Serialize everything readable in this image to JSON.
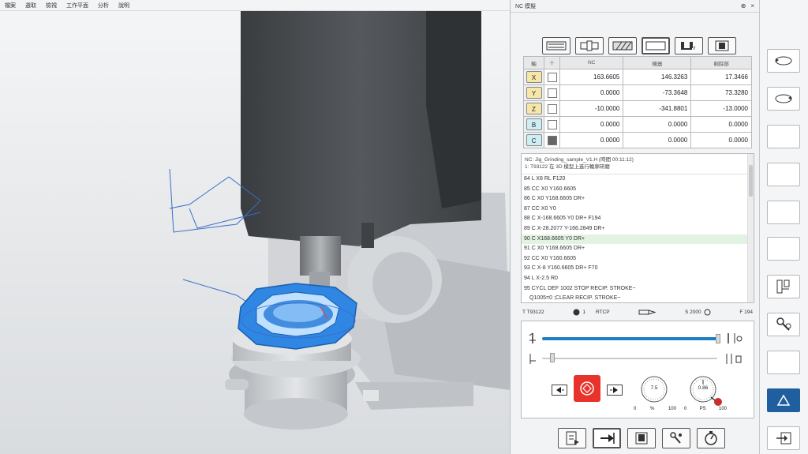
{
  "menu": [
    "檔案",
    "選取",
    "檢視",
    "工作平面",
    "分析",
    "說明"
  ],
  "panel": {
    "title": "NC 模擬",
    "ctl_pin": "⊕",
    "ctl_close": "×"
  },
  "mode_buttons": [
    {
      "icon": "lines-icon"
    },
    {
      "icon": "tool-holder-icon"
    },
    {
      "icon": "hatch-icon"
    },
    {
      "icon": "rectangle-icon"
    },
    {
      "icon": "machine-icon"
    },
    {
      "icon": "program-icon"
    }
  ],
  "axes_table": {
    "headers": [
      "軸",
      "-|-",
      "NC",
      "機器",
      "剩餘部"
    ],
    "rows": [
      {
        "axis": "X",
        "color": "#f6e6a9",
        "checked": false,
        "nc": "163.6605",
        "machine": "146.3263",
        "remain": "17.3466"
      },
      {
        "axis": "Y",
        "color": "#f6e6a9",
        "checked": false,
        "nc": "0.0000",
        "machine": "-73.3648",
        "remain": "73.3280"
      },
      {
        "axis": "Z",
        "color": "#f6e6a9",
        "checked": false,
        "nc": "-10.0000",
        "machine": "-341.8801",
        "remain": "-13.0000"
      },
      {
        "axis": "B",
        "color": "#cdeef2",
        "checked": false,
        "nc": "0.0000",
        "machine": "0.0000",
        "remain": "0.0000"
      },
      {
        "axis": "C",
        "color": "#cdeef2",
        "checked": true,
        "nc": "0.0000",
        "machine": "0.0000",
        "remain": "0.0000"
      }
    ]
  },
  "program": {
    "header1": "NC: Jig_Grinding_sample_V1.H (時間 00:11:12)",
    "header2": "1: T93122 在 3D 模型上進行輪廓研磨",
    "lines": [
      "84 L X8 RL F120",
      "85 CC X0 Y160.6605",
      "86 C X0 Y168.6605 DR+",
      "87 CC X0 Y0",
      "88 C X-168.6605 Y0 DR+ F194",
      "89 C X-28.2077 Y-166.2849 DR+",
      "90 C X168.6605 Y0 DR+",
      "91 C X0 Y168.6605 DR+",
      "92 CC X0 Y160.6605",
      "93 C X-8 Y160.6605 DR+ F70",
      "94 L X-2.5 R0",
      "95 CYCL DEF 1002 STOP RECIP. STROKE~",
      "Q1005=0 ;CLEAR RECIP. STROKE~"
    ],
    "highlight_index": 6
  },
  "status": {
    "tool": "T T93122",
    "tool_no": "1",
    "tcp": "RTCP",
    "spindle": "S 2000",
    "feed": "F 194"
  },
  "controls": {
    "dial1": {
      "value": "7.5",
      "min": "0",
      "unit": "%",
      "max": "100"
    },
    "dial2": {
      "value": "0.86",
      "min": "0",
      "unit": "PS",
      "max": "100"
    }
  },
  "bottom_buttons": [
    {
      "icon": "nc-file-icon"
    },
    {
      "icon": "step-arrow-icon"
    },
    {
      "icon": "machine-view-icon"
    },
    {
      "icon": "wrench-link-icon"
    },
    {
      "icon": "gauge-icon"
    }
  ],
  "side_buttons": [
    {
      "icon": "rotate-view-icon"
    },
    {
      "icon": "rotate-view-2-icon"
    },
    {
      "icon": "blank-icon"
    },
    {
      "icon": "blank-icon"
    },
    {
      "icon": "blank-icon"
    },
    {
      "icon": "blank-icon"
    },
    {
      "icon": "tool-setup-icon"
    },
    {
      "icon": "wrench-gear-icon"
    },
    {
      "icon": "blank-icon"
    },
    {
      "icon": "triangle-up-icon"
    },
    {
      "icon": "export-icon"
    }
  ]
}
